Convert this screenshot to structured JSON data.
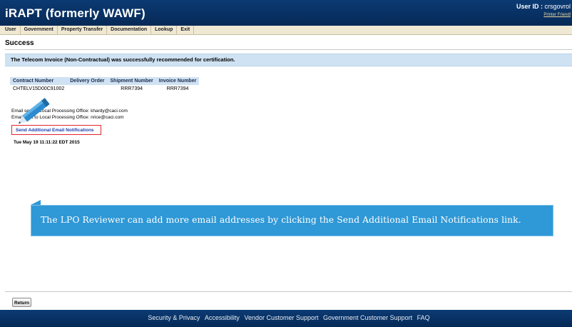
{
  "header": {
    "app_title": "iRAPT (formerly WAWF)",
    "user_label": "User ID :",
    "user_value": "crsgovrol",
    "printer_friendly": "Printer Friendl"
  },
  "menu": [
    {
      "label": "User"
    },
    {
      "label": "Government"
    },
    {
      "label": "Property Transfer"
    },
    {
      "label": "Documentation"
    },
    {
      "label": "Lookup"
    },
    {
      "label": "Exit"
    }
  ],
  "page_title": "Success",
  "success_message": "The Telecom Invoice (Non-Contractual) was successfully recommended for certification.",
  "table": {
    "headers": [
      "Contract Number",
      "Delivery Order",
      "Shipment Number",
      "Invoice Number"
    ],
    "row": [
      "CHTELV15D00C91002",
      "",
      "RRR7394",
      "RRR7394"
    ]
  },
  "emails": {
    "line1": "Email sent to Local Processing Office: khardy@caci.com",
    "line2": "Email sent to Local Processing Office: nrice@caci.com"
  },
  "send_link": "Send Additional Email Notifications",
  "timestamp": "Tue May 19 11:11:22 EDT 2015",
  "callout": "The LPO Reviewer can add more email addresses by clicking the Send Additional Email Notifications link.",
  "return_button": "Return",
  "footer": [
    "Security & Privacy",
    "Accessibility",
    "Vendor Customer Support",
    "Government Customer Support",
    "FAQ"
  ],
  "colors": {
    "header_bg": "#0b3a73",
    "banner_bg": "#cfe2f3",
    "callout_bg": "#2f98d6",
    "highlight_border": "#e0262b",
    "link": "#1a3fb0"
  },
  "icons": {
    "pointer": "pencil-icon"
  }
}
